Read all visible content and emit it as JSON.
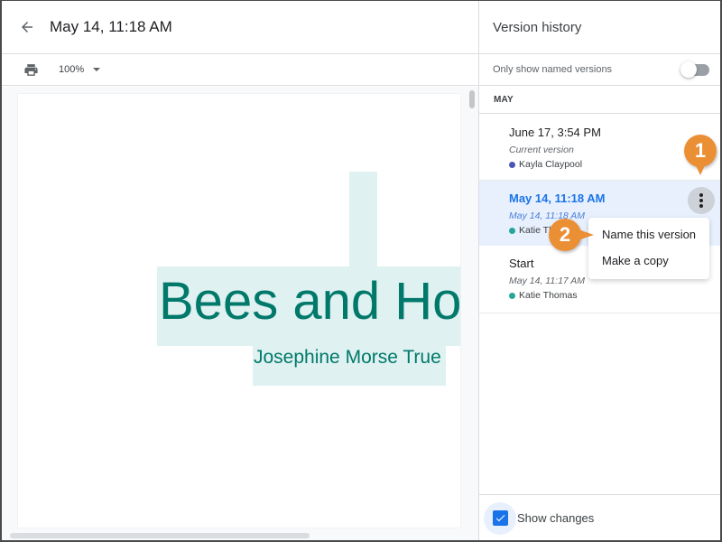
{
  "header": {
    "title": "May 14, 11:18 AM",
    "back_icon": "arrow-back-icon"
  },
  "toolbar": {
    "print_icon": "print-icon",
    "zoom_level": "100%"
  },
  "document": {
    "heading": "Bees and Hor",
    "subtitle": "Josephine Morse True",
    "heading_color": "#00796b",
    "highlight_color": "#dff1f0"
  },
  "version_history": {
    "title": "Version history",
    "filter_label": "Only show named versions",
    "filter_on": false,
    "month": "MAY",
    "versions": [
      {
        "title": "June 17, 3:54 PM",
        "subtitle": "Current version",
        "user": "Kayla Claypool",
        "user_color": "#4b55b5"
      },
      {
        "title": "May 14, 11:18 AM",
        "subtitle": "May 14, 11:18 AM",
        "user": "Katie Thomas",
        "user_color": "#26a69a",
        "selected": true
      },
      {
        "title": "Start",
        "subtitle": "May 14, 11:17 AM",
        "user": "Katie Thomas",
        "user_color": "#26a69a"
      }
    ],
    "menu": [
      {
        "label": "Name this version"
      },
      {
        "label": "Make a copy"
      }
    ],
    "show_changes_label": "Show changes",
    "show_changes_checked": true
  },
  "callouts": [
    "1",
    "2"
  ],
  "colors": {
    "accent": "#1a73e8",
    "callout": "#eb8f35",
    "selected_row": "#e8f0fe"
  }
}
